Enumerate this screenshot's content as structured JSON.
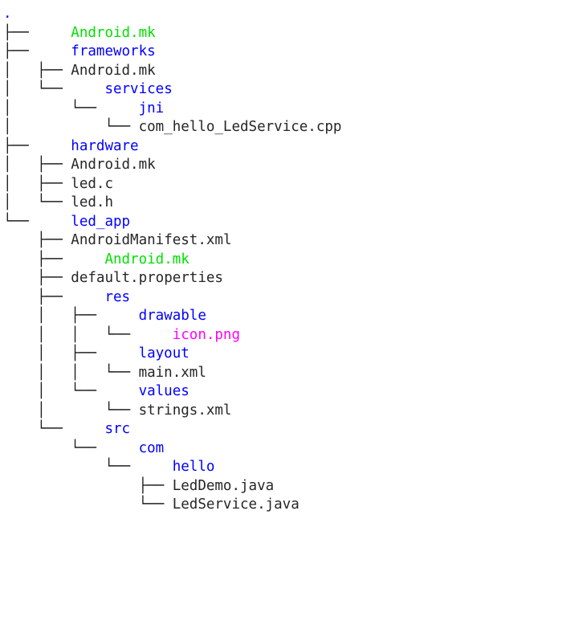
{
  "terminal": {
    "command_output_type": "tree",
    "background": "#ffffff",
    "colors": {
      "directory": "#0000ff",
      "executable": "#00e000",
      "image": "#ff00ff",
      "file": "#262626",
      "guide": "#1a1a1a"
    }
  },
  "tree": {
    "root_label": ".",
    "lines": [
      {
        "guides": "",
        "name": ".",
        "kind": "root"
      },
      {
        "guides": "├──     ",
        "name": "Android.mk",
        "kind": "exec"
      },
      {
        "guides": "├──     ",
        "name": "frameworks",
        "kind": "dir"
      },
      {
        "guides": "│   ├── ",
        "name": "Android.mk",
        "kind": "file"
      },
      {
        "guides": "│   └──     ",
        "name": "services",
        "kind": "dir"
      },
      {
        "guides": "│       └──     ",
        "name": "jni",
        "kind": "dir"
      },
      {
        "guides": "│           └── ",
        "name": "com_hello_LedService.cpp",
        "kind": "file"
      },
      {
        "guides": "├──     ",
        "name": "hardware",
        "kind": "dir"
      },
      {
        "guides": "│   ├── ",
        "name": "Android.mk",
        "kind": "file"
      },
      {
        "guides": "│   ├── ",
        "name": "led.c",
        "kind": "file"
      },
      {
        "guides": "│   └── ",
        "name": "led.h",
        "kind": "file"
      },
      {
        "guides": "└──     ",
        "name": "led_app",
        "kind": "dir"
      },
      {
        "guides": "    ├── ",
        "name": "AndroidManifest.xml",
        "kind": "file"
      },
      {
        "guides": "    ├──     ",
        "name": "Android.mk",
        "kind": "exec"
      },
      {
        "guides": "    ├── ",
        "name": "default.properties",
        "kind": "file"
      },
      {
        "guides": "    ├──     ",
        "name": "res",
        "kind": "dir"
      },
      {
        "guides": "    │   ├──     ",
        "name": "drawable",
        "kind": "dir"
      },
      {
        "guides": "    │   │   └──     ",
        "name": "icon.png",
        "kind": "img"
      },
      {
        "guides": "    │   ├──     ",
        "name": "layout",
        "kind": "dir"
      },
      {
        "guides": "    │   │   └── ",
        "name": "main.xml",
        "kind": "file"
      },
      {
        "guides": "    │   └──     ",
        "name": "values",
        "kind": "dir"
      },
      {
        "guides": "    │       └── ",
        "name": "strings.xml",
        "kind": "file"
      },
      {
        "guides": "    └──     ",
        "name": "src",
        "kind": "dir"
      },
      {
        "guides": "        └──     ",
        "name": "com",
        "kind": "dir"
      },
      {
        "guides": "            └──     ",
        "name": "hello",
        "kind": "dir"
      },
      {
        "guides": "                ├── ",
        "name": "LedDemo.java",
        "kind": "file"
      },
      {
        "guides": "                └── ",
        "name": "LedService.java",
        "kind": "file"
      }
    ]
  }
}
